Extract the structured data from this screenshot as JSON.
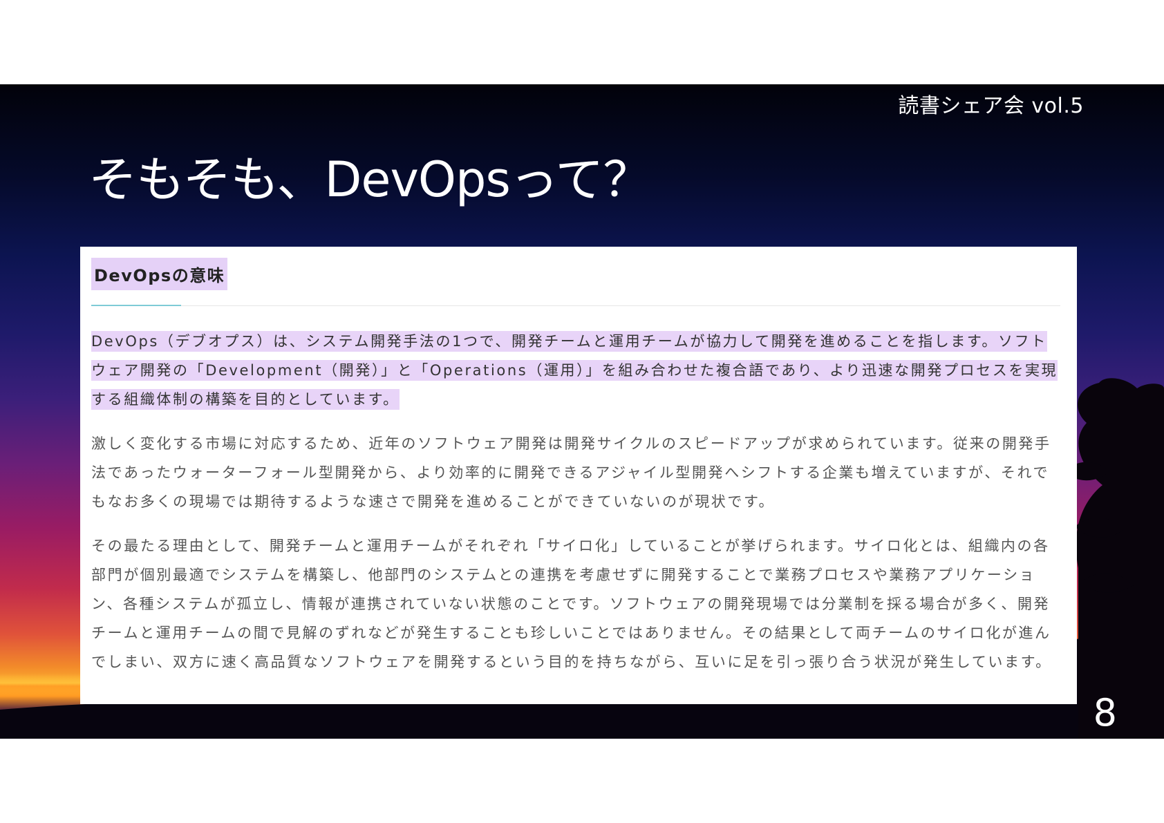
{
  "header": {
    "label": "読書シェア会 vol.5"
  },
  "slide": {
    "title": "そもそも、DevOpsって？",
    "page_number": "8"
  },
  "article": {
    "heading": "DevOpsの意味",
    "paragraphs": [
      "DevOps（デブオプス）は、システム開発手法の1つで、開発チームと運用チームが協力して開発を進めることを指します。ソフトウェア開発の「Development（開発）」と「Operations（運用）」を組み合わせた複合語であり、より迅速な開発プロセスを実現する組織体制の構築を目的としています。",
      "激しく変化する市場に対応するため、近年のソフトウェア開発は開発サイクルのスピードアップが求められています。従来の開発手法であったウォーターフォール型開発から、より効率的に開発できるアジャイル型開発へシフトする企業も増えていますが、それでもなお多くの現場では期待するような速さで開発を進めることができていないのが現状です。",
      "その最たる理由として、開発チームと運用チームがそれぞれ「サイロ化」していることが挙げられます。サイロ化とは、組織内の各部門が個別最適でシステムを構築し、他部門のシステムとの連携を考慮せずに開発することで業務プロセスや業務アプリケーション、各種システムが孤立し、情報が連携されていない状態のことです。ソフトウェアの開発現場では分業制を採る場合が多く、開発チームと運用チームの間で見解のずれなどが発生することも珍しいことではありません。その結果として両チームのサイロ化が進んでしまい、双方に速く高品質なソフトウェアを開発するという目的を持ちながら、互いに足を引っ張り合う状況が発生しています。"
    ]
  },
  "colors": {
    "highlight": "#e8d4f8",
    "heading_accent": "#7ecbd6",
    "body_text": "#555555"
  }
}
